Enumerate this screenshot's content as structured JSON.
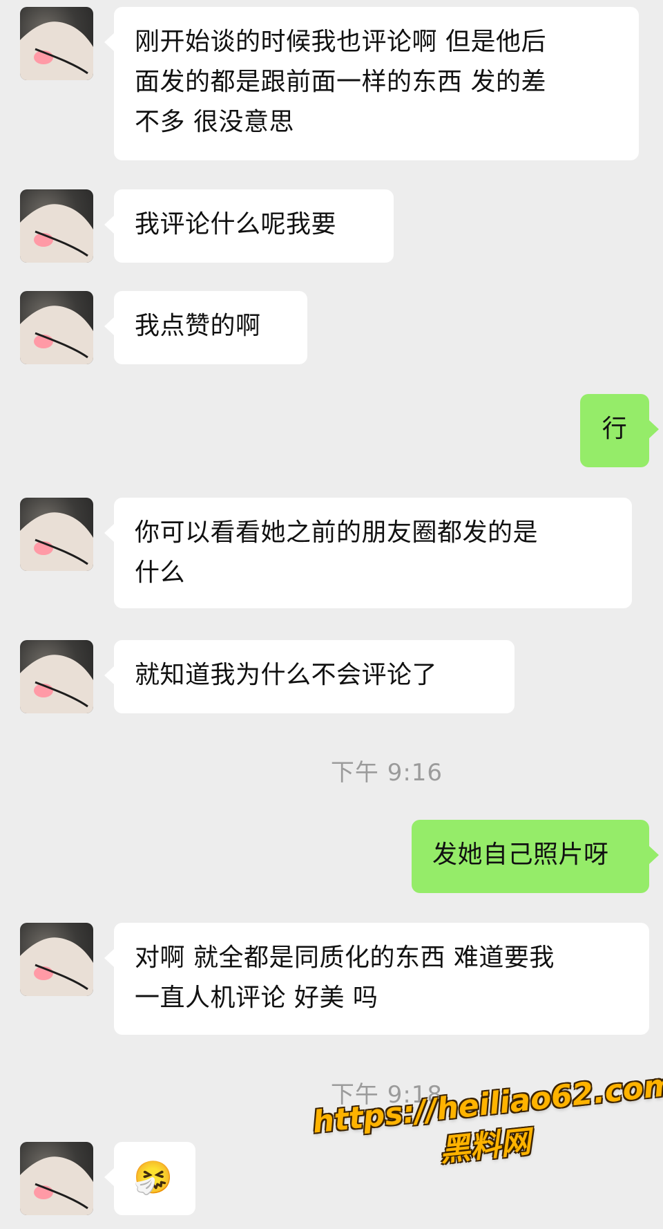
{
  "chat": {
    "messages": [
      {
        "side": "left",
        "text": "刚开始谈的时候我也评论啊 但是他后\n面发的都是跟前面一样的东西 发的差\n不多 很没意思"
      },
      {
        "side": "left",
        "text": "我评论什么呢我要"
      },
      {
        "side": "left",
        "text": "我点赞的啊"
      },
      {
        "side": "right",
        "text": "行"
      },
      {
        "side": "left",
        "text": "你可以看看她之前的朋友圈都发的是\n什么"
      },
      {
        "side": "left",
        "text": "就知道我为什么不会评论了"
      },
      {
        "time": "下午 9:16"
      },
      {
        "side": "right",
        "text": "发她自己照片呀"
      },
      {
        "side": "left",
        "text": "对啊 就全都是同质化的东西 难道要我\n一直人机评论 好美 吗"
      },
      {
        "time": "下午 9:18"
      },
      {
        "side": "left",
        "emoji": "🤧"
      }
    ]
  },
  "watermark": {
    "url": "https://heiliao62.com",
    "name": "黑料网",
    "color": "#ffb300"
  },
  "colors": {
    "background": "#ededed",
    "incoming_bubble": "#ffffff",
    "outgoing_bubble": "#95ec69",
    "timestamp": "#9b9b9b"
  }
}
